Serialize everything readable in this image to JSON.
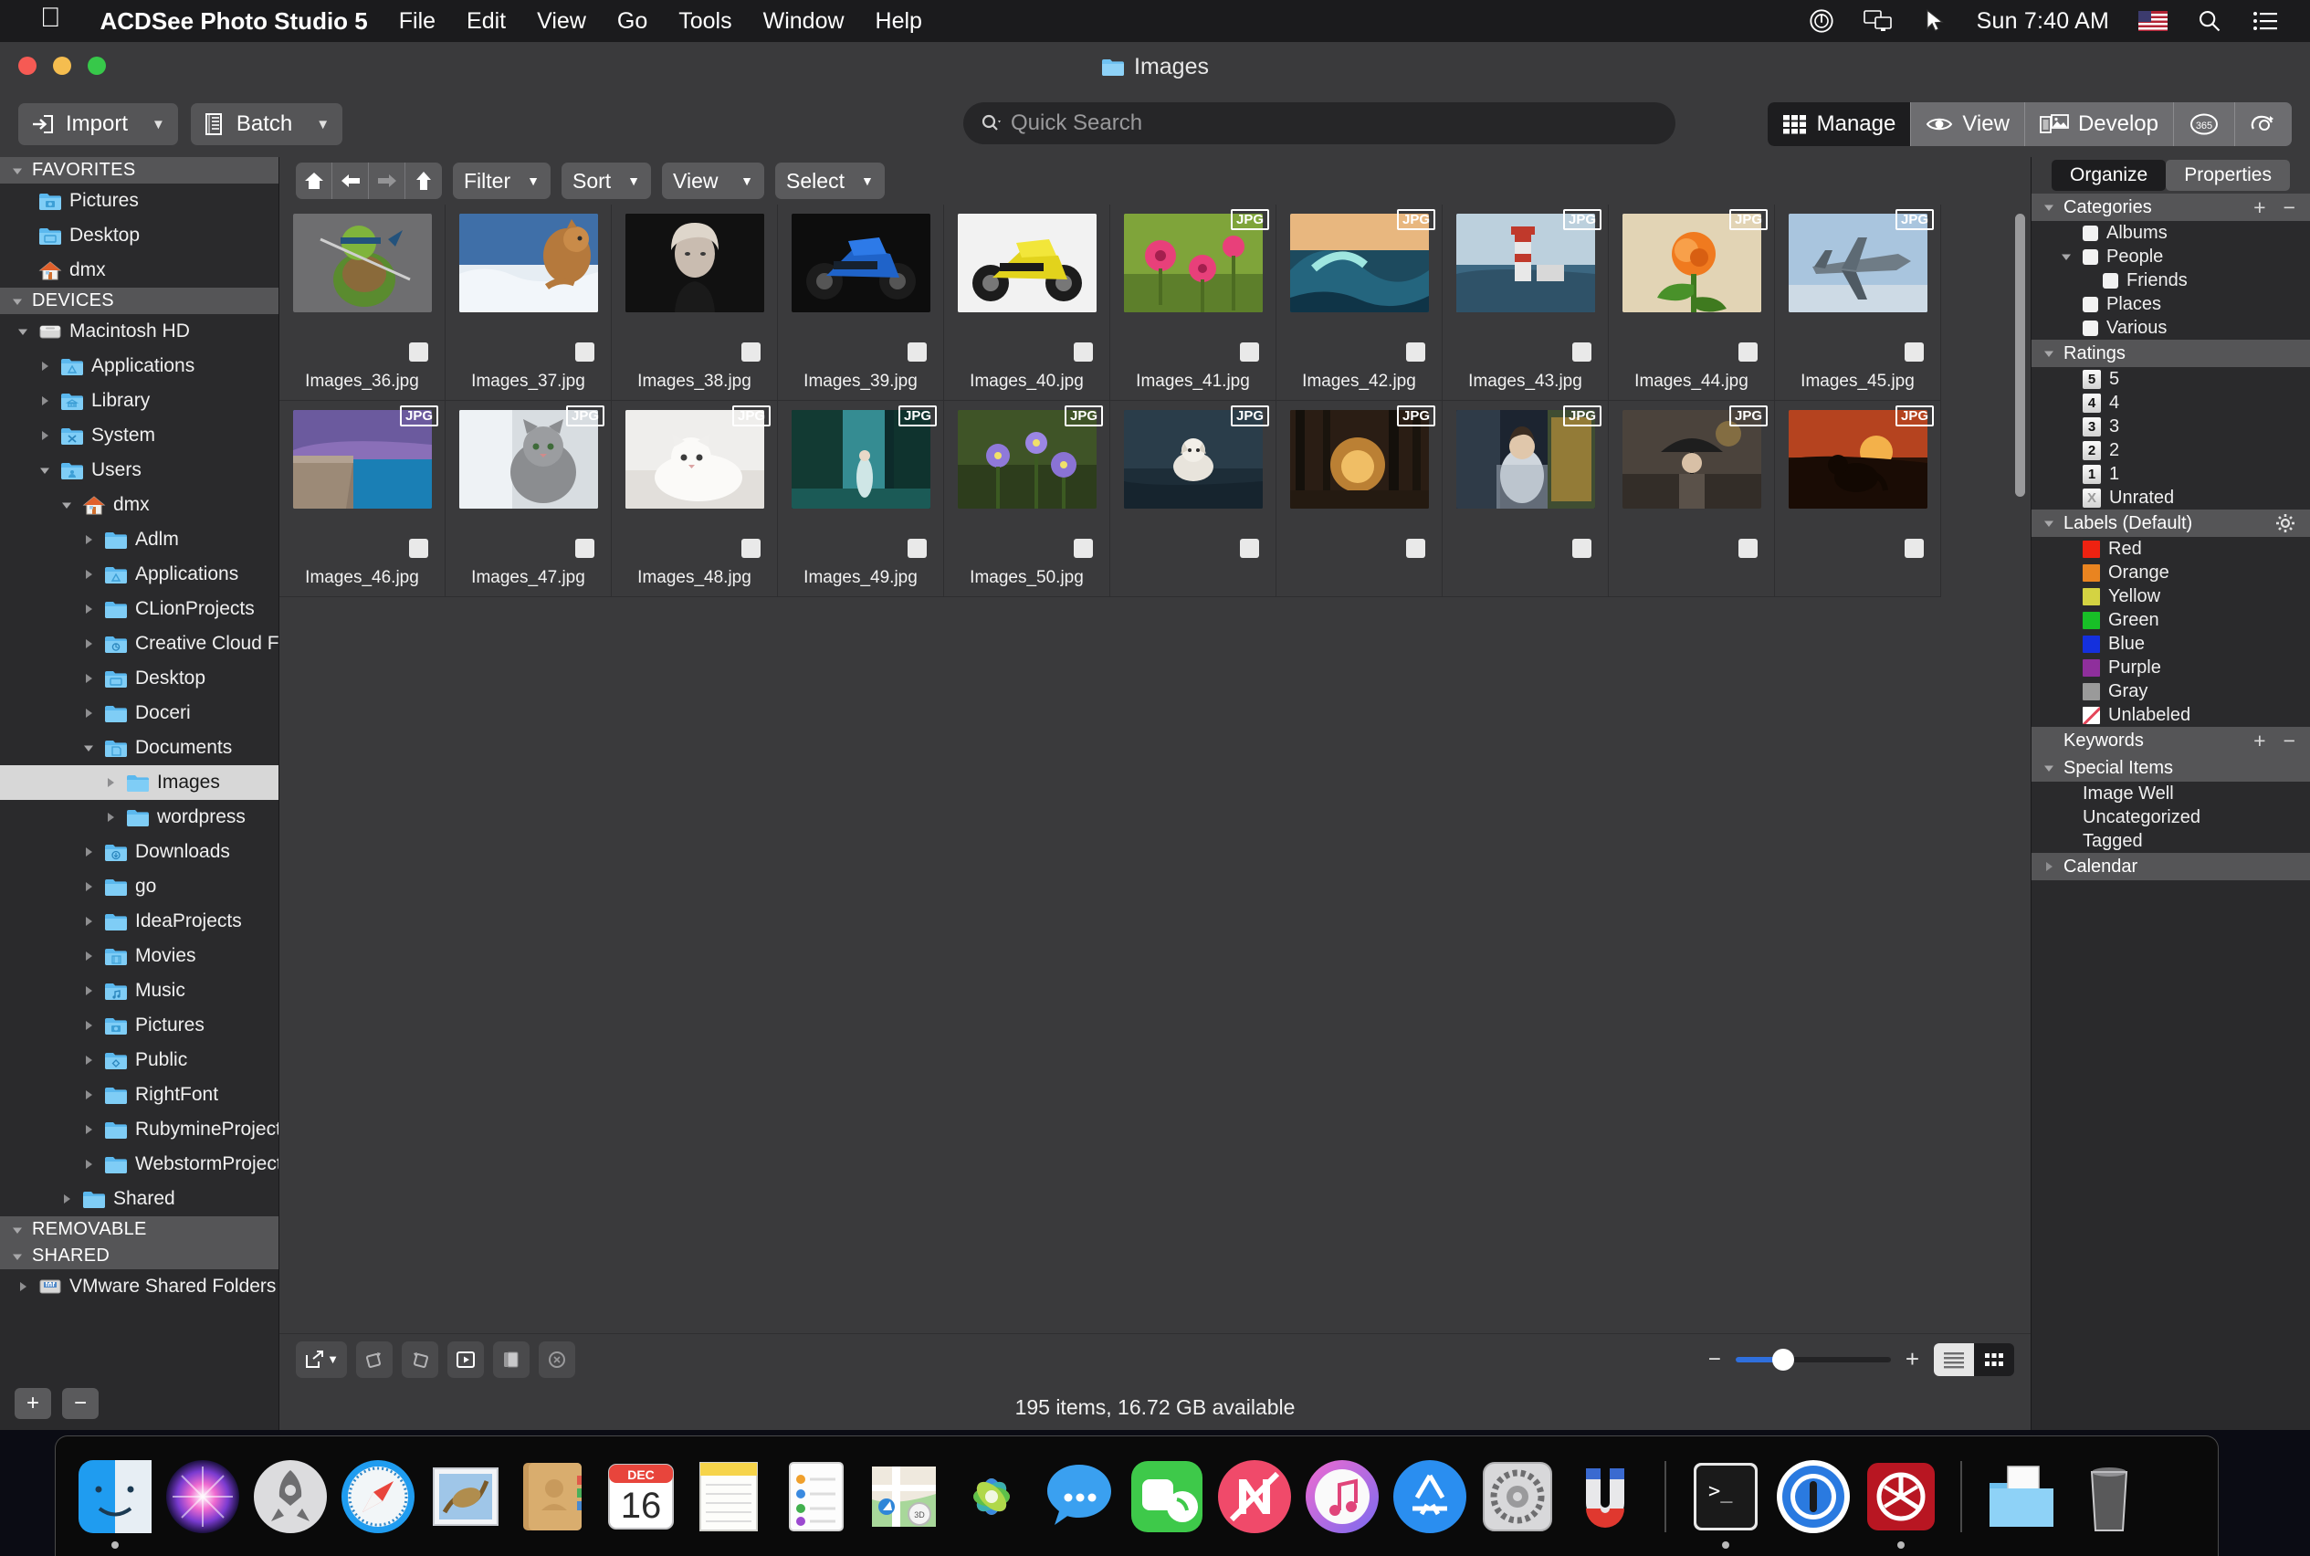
{
  "menubar": {
    "apple": "apple-logo",
    "app_name": "ACDSee Photo Studio 5",
    "items": [
      "File",
      "Edit",
      "View",
      "Go",
      "Tools",
      "Window",
      "Help"
    ],
    "clock": "Sun 7:40 AM",
    "status_icons": [
      "power-icon",
      "screen-mirroring-icon",
      "pointer-icon",
      "us-flag-icon",
      "spotlight-search-icon",
      "control-center-icon"
    ]
  },
  "window": {
    "title": "Images",
    "title_icon": "folder-icon",
    "traffic_lights": [
      "close-button",
      "minimize-button",
      "zoom-button"
    ]
  },
  "toolbar": {
    "import_label": "Import",
    "batch_label": "Batch",
    "search": {
      "placeholder": "Quick Search",
      "icon": "search-icon"
    },
    "modes": [
      {
        "label": "Manage",
        "icon": "grid-icon",
        "active": true
      },
      {
        "label": "View",
        "icon": "eye-icon",
        "active": false
      },
      {
        "label": "Develop",
        "icon": "develop-icon",
        "active": false
      },
      {
        "label": "365",
        "icon": "365-icon",
        "active": false
      },
      {
        "label": "",
        "icon": "shutter-icon",
        "active": false
      }
    ]
  },
  "navbar": {
    "nav_icons": [
      "home-icon",
      "back-arrow-icon",
      "forward-arrow-icon",
      "up-arrow-icon"
    ],
    "dropdowns": [
      "Filter",
      "Sort",
      "View",
      "Select"
    ]
  },
  "sidebar": {
    "groups": [
      {
        "title": "FAVORITES",
        "expanded": true,
        "items": [
          {
            "label": "Pictures",
            "indent": 1,
            "icon": "pictures-folder-icon",
            "twisty": "none"
          },
          {
            "label": "Desktop",
            "indent": 1,
            "icon": "desktop-folder-icon",
            "twisty": "none"
          },
          {
            "label": "dmx",
            "indent": 1,
            "icon": "home-folder-icon",
            "twisty": "none"
          }
        ]
      },
      {
        "title": "DEVICES",
        "expanded": true,
        "items": [
          {
            "label": "Macintosh HD",
            "indent": 1,
            "icon": "hard-drive-icon",
            "twisty": "down"
          },
          {
            "label": "Applications",
            "indent": 2,
            "icon": "applications-folder-icon",
            "twisty": "right"
          },
          {
            "label": "Library",
            "indent": 2,
            "icon": "library-folder-icon",
            "twisty": "right"
          },
          {
            "label": "System",
            "indent": 2,
            "icon": "system-folder-icon",
            "twisty": "right"
          },
          {
            "label": "Users",
            "indent": 2,
            "icon": "users-folder-icon",
            "twisty": "down"
          },
          {
            "label": "dmx",
            "indent": 3,
            "icon": "home-folder-icon",
            "twisty": "down"
          },
          {
            "label": "Adlm",
            "indent": 4,
            "icon": "folder-icon",
            "twisty": "right"
          },
          {
            "label": "Applications",
            "indent": 4,
            "icon": "applications-folder-icon",
            "twisty": "right"
          },
          {
            "label": "CLionProjects",
            "indent": 4,
            "icon": "folder-icon",
            "twisty": "right"
          },
          {
            "label": "Creative Cloud Files",
            "indent": 4,
            "icon": "creative-cloud-folder-icon",
            "twisty": "right"
          },
          {
            "label": "Desktop",
            "indent": 4,
            "icon": "desktop-folder-icon",
            "twisty": "right"
          },
          {
            "label": "Doceri",
            "indent": 4,
            "icon": "folder-icon",
            "twisty": "right"
          },
          {
            "label": "Documents",
            "indent": 4,
            "icon": "documents-folder-icon",
            "twisty": "down"
          },
          {
            "label": "Images",
            "indent": 5,
            "icon": "folder-icon",
            "twisty": "right",
            "selected": true
          },
          {
            "label": "wordpress",
            "indent": 5,
            "icon": "folder-icon",
            "twisty": "right"
          },
          {
            "label": "Downloads",
            "indent": 4,
            "icon": "downloads-folder-icon",
            "twisty": "right"
          },
          {
            "label": "go",
            "indent": 4,
            "icon": "folder-icon",
            "twisty": "right"
          },
          {
            "label": "IdeaProjects",
            "indent": 4,
            "icon": "folder-icon",
            "twisty": "right"
          },
          {
            "label": "Movies",
            "indent": 4,
            "icon": "movies-folder-icon",
            "twisty": "right"
          },
          {
            "label": "Music",
            "indent": 4,
            "icon": "music-folder-icon",
            "twisty": "right"
          },
          {
            "label": "Pictures",
            "indent": 4,
            "icon": "pictures-folder-icon",
            "twisty": "right"
          },
          {
            "label": "Public",
            "indent": 4,
            "icon": "public-folder-icon",
            "twisty": "right"
          },
          {
            "label": "RightFont",
            "indent": 4,
            "icon": "folder-icon",
            "twisty": "right"
          },
          {
            "label": "RubymineProjects",
            "indent": 4,
            "icon": "folder-icon",
            "twisty": "right"
          },
          {
            "label": "WebstormProjects",
            "indent": 4,
            "icon": "folder-icon",
            "twisty": "right"
          },
          {
            "label": "Shared",
            "indent": 3,
            "icon": "folder-icon",
            "twisty": "right"
          }
        ]
      },
      {
        "title": "REMOVABLE",
        "expanded": true,
        "items": []
      },
      {
        "title": "SHARED",
        "expanded": true,
        "items": [
          {
            "label": "VMware Shared Folders",
            "indent": 1,
            "icon": "network-drive-icon",
            "twisty": "right",
            "eject": true
          }
        ]
      }
    ],
    "footer": {
      "add": "+",
      "remove": "−"
    }
  },
  "grid": {
    "items": [
      {
        "name": "Images_36.jpg",
        "badge": "",
        "art": "turtle"
      },
      {
        "name": "Images_37.jpg",
        "badge": "",
        "art": "cougar"
      },
      {
        "name": "Images_38.jpg",
        "badge": "",
        "art": "portrait"
      },
      {
        "name": "Images_39.jpg",
        "badge": "",
        "art": "bluebike"
      },
      {
        "name": "Images_40.jpg",
        "badge": "",
        "art": "yellowbike"
      },
      {
        "name": "Images_41.jpg",
        "badge": "JPG",
        "art": "poppies"
      },
      {
        "name": "Images_42.jpg",
        "badge": "JPG",
        "art": "wave"
      },
      {
        "name": "Images_43.jpg",
        "badge": "JPG",
        "art": "lighthouse"
      },
      {
        "name": "Images_44.jpg",
        "badge": "JPG",
        "art": "rose"
      },
      {
        "name": "Images_45.jpg",
        "badge": "JPG",
        "art": "jet"
      },
      {
        "name": "Images_46.jpg",
        "badge": "JPG",
        "art": "beach"
      },
      {
        "name": "Images_47.jpg",
        "badge": "JPG",
        "art": "graycat"
      },
      {
        "name": "Images_48.jpg",
        "badge": "JPG",
        "art": "whitecat"
      },
      {
        "name": "Images_49.jpg",
        "badge": "JPG",
        "art": "waterfall"
      },
      {
        "name": "Images_50.jpg",
        "badge": "JPG",
        "art": "violets"
      },
      {
        "name": "",
        "badge": "JPG",
        "art": "dogwater"
      },
      {
        "name": "",
        "badge": "JPG",
        "art": "sunsetforest"
      },
      {
        "name": "",
        "badge": "JPG",
        "art": "womanwindow"
      },
      {
        "name": "",
        "badge": "JPG",
        "art": "umbrella"
      },
      {
        "name": "",
        "badge": "JPG",
        "art": "dogsunset"
      }
    ]
  },
  "bottombar": {
    "icons": [
      "open-with-icon",
      "rotate-right-icon",
      "rotate-left-icon",
      "slideshow-icon",
      "compare-icon",
      "refresh-icon"
    ],
    "zoom": {
      "minus": "−",
      "plus": "+",
      "value": 24
    },
    "view_toggle": [
      "list-view-icon",
      "thumbnail-view-icon"
    ]
  },
  "status": {
    "text": "195 items, 16.72 GB available"
  },
  "rightpanel": {
    "tabs": [
      {
        "label": "Organize",
        "active": true
      },
      {
        "label": "Properties",
        "active": false
      }
    ],
    "sections": [
      {
        "title": "Categories",
        "twisty": "down",
        "controls": [
          "+",
          "−"
        ],
        "rows": [
          {
            "label": "Albums",
            "type": "check",
            "indent": 1,
            "twisty": "none"
          },
          {
            "label": "People",
            "type": "check",
            "indent": 1,
            "twisty": "down"
          },
          {
            "label": "Friends",
            "type": "check",
            "indent": 2,
            "twisty": "none"
          },
          {
            "label": "Places",
            "type": "check",
            "indent": 1,
            "twisty": "none"
          },
          {
            "label": "Various",
            "type": "check",
            "indent": 1,
            "twisty": "none"
          }
        ]
      },
      {
        "title": "Ratings",
        "twisty": "down",
        "controls": [],
        "rows": [
          {
            "label": "5",
            "type": "rate",
            "glyph": "5",
            "indent": 1
          },
          {
            "label": "4",
            "type": "rate",
            "glyph": "4",
            "indent": 1
          },
          {
            "label": "3",
            "type": "rate",
            "glyph": "3",
            "indent": 1
          },
          {
            "label": "2",
            "type": "rate",
            "glyph": "2",
            "indent": 1
          },
          {
            "label": "1",
            "type": "rate",
            "glyph": "1",
            "indent": 1
          },
          {
            "label": "Unrated",
            "type": "rate",
            "glyph": "X",
            "indent": 1
          }
        ]
      },
      {
        "title": "Labels (Default)",
        "twisty": "down",
        "controls": [
          "gear-icon"
        ],
        "rows": [
          {
            "label": "Red",
            "type": "swatch",
            "color": "#ee2211",
            "indent": 1
          },
          {
            "label": "Orange",
            "type": "swatch",
            "color": "#e98420",
            "indent": 1
          },
          {
            "label": "Yellow",
            "type": "swatch",
            "color": "#d4d342",
            "indent": 1
          },
          {
            "label": "Green",
            "type": "swatch",
            "color": "#18bf27",
            "indent": 1
          },
          {
            "label": "Blue",
            "type": "swatch",
            "color": "#1430dd",
            "indent": 1
          },
          {
            "label": "Purple",
            "type": "swatch",
            "color": "#8f2f9c",
            "indent": 1
          },
          {
            "label": "Gray",
            "type": "swatch",
            "color": "#9a9a9a",
            "indent": 1
          },
          {
            "label": "Unlabeled",
            "type": "swatch-unlabeled",
            "color": "#ffffff",
            "indent": 1
          }
        ]
      },
      {
        "title": "Keywords",
        "twisty": "none",
        "controls": [
          "+",
          "−"
        ],
        "rows": []
      },
      {
        "title": "Special Items",
        "twisty": "down",
        "controls": [],
        "rows": [
          {
            "label": "Image Well",
            "type": "plain",
            "indent": 1
          },
          {
            "label": "Uncategorized",
            "type": "plain",
            "indent": 1
          },
          {
            "label": "Tagged",
            "type": "plain",
            "indent": 1
          }
        ]
      },
      {
        "title": "Calendar",
        "twisty": "right",
        "controls": [],
        "rows": []
      }
    ]
  },
  "dock": {
    "items": [
      {
        "name": "Finder",
        "icon": "finder-icon",
        "running": true
      },
      {
        "name": "Siri",
        "icon": "siri-icon",
        "running": false
      },
      {
        "name": "Launchpad",
        "icon": "launchpad-icon",
        "running": false
      },
      {
        "name": "Safari",
        "icon": "safari-icon",
        "running": false
      },
      {
        "name": "Mail",
        "icon": "mail-icon",
        "running": false
      },
      {
        "name": "Contacts",
        "icon": "contacts-icon",
        "running": false
      },
      {
        "name": "Calendar",
        "icon": "calendar-icon",
        "running": false,
        "month": "DEC",
        "day": "16"
      },
      {
        "name": "Notes",
        "icon": "notes-icon",
        "running": false
      },
      {
        "name": "Reminders",
        "icon": "reminders-icon",
        "running": false
      },
      {
        "name": "Maps",
        "icon": "maps-icon",
        "running": false
      },
      {
        "name": "Photos",
        "icon": "photos-icon",
        "running": false
      },
      {
        "name": "Messages",
        "icon": "messages-icon",
        "running": false
      },
      {
        "name": "FaceTime",
        "icon": "facetime-icon",
        "running": false
      },
      {
        "name": "News",
        "icon": "news-icon",
        "running": false
      },
      {
        "name": "iTunes",
        "icon": "itunes-icon",
        "running": false
      },
      {
        "name": "App Store",
        "icon": "appstore-icon",
        "running": false
      },
      {
        "name": "System Preferences",
        "icon": "system-preferences-icon",
        "running": false
      },
      {
        "name": "Magnet",
        "icon": "magnet-icon",
        "running": false
      },
      {
        "name": "Terminal",
        "icon": "terminal-icon",
        "running": true
      },
      {
        "name": "1Password",
        "icon": "onepassword-icon",
        "running": false
      },
      {
        "name": "ACDSee",
        "icon": "acdsee-icon",
        "running": true
      },
      {
        "name": "Downloads",
        "icon": "downloads-stack-icon",
        "running": false
      },
      {
        "name": "Trash",
        "icon": "trash-icon",
        "running": false
      }
    ]
  }
}
